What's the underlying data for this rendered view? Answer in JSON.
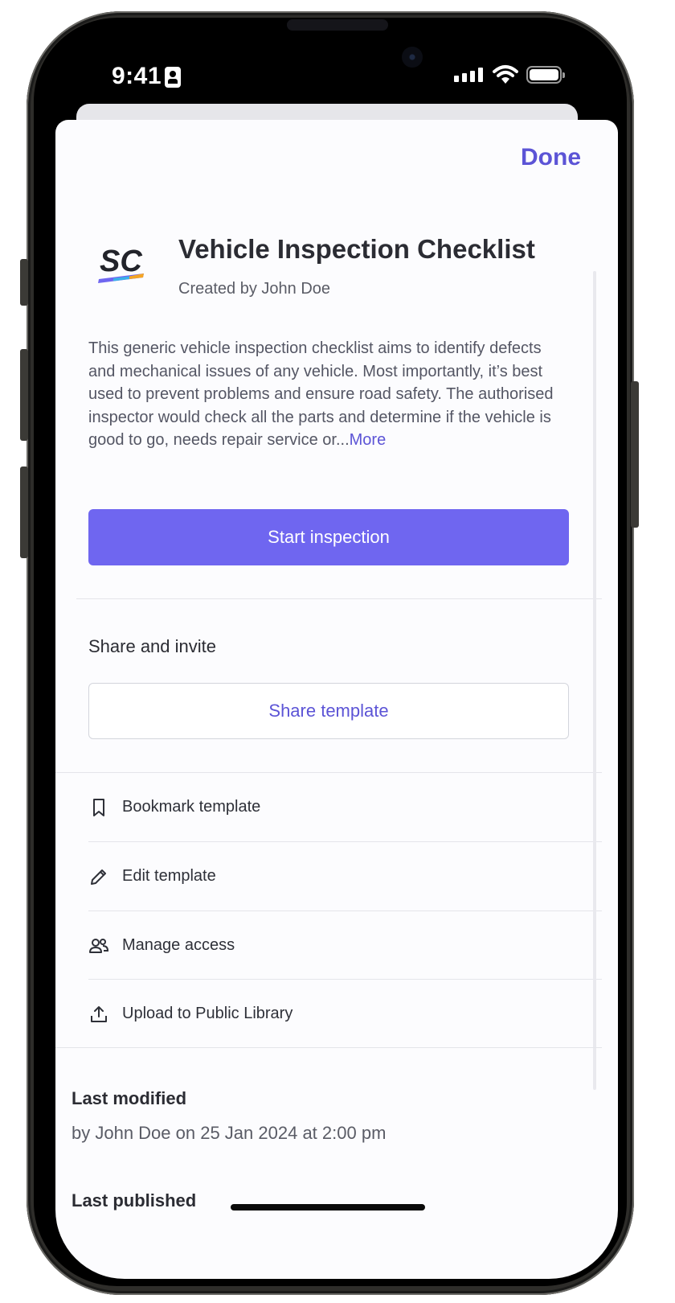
{
  "status_bar": {
    "time": "9:41"
  },
  "sheet": {
    "done_label": "Done",
    "logo_text": "SC",
    "title": "Vehicle Inspection Checklist",
    "created_by": "Created by John Doe",
    "description": "This generic vehicle inspection checklist aims to identify defects and mechanical issues of any vehicle. Most importantly, it’s best used to prevent problems and ensure road safety. The authorised inspector would check all the parts and determine if the vehicle is good to go, needs repair service or...",
    "more_label": "More",
    "start_button": "Start inspection",
    "share_section_title": "Share and invite",
    "share_button": "Share template",
    "actions": [
      {
        "label": "Bookmark template",
        "icon": "bookmark-icon"
      },
      {
        "label": "Edit template",
        "icon": "pencil-icon"
      },
      {
        "label": "Manage access",
        "icon": "users-icon"
      },
      {
        "label": "Upload to Public Library",
        "icon": "upload-icon"
      }
    ],
    "last_modified_title": "Last modified",
    "last_modified_value": "by John Doe on 25 Jan 2024 at 2:00 pm",
    "last_published_title": "Last published"
  },
  "colors": {
    "accent": "#6f66f0",
    "link": "#5c54d6",
    "text": "#2b2c33"
  }
}
